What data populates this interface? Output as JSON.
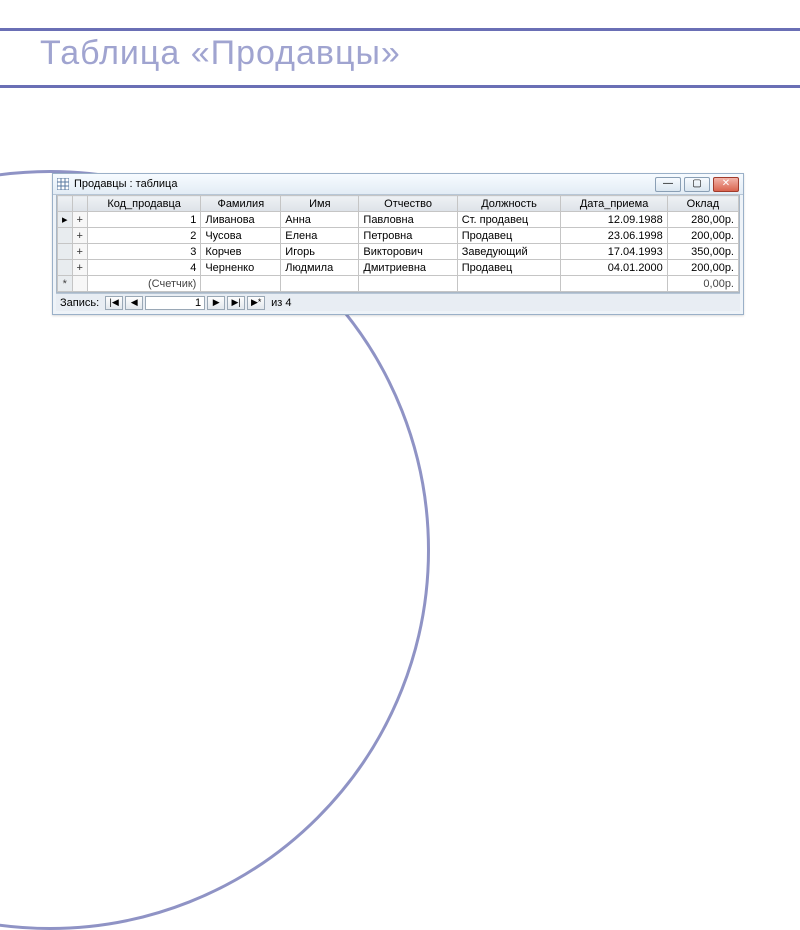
{
  "slide": {
    "title": "Таблица «Продавцы»"
  },
  "window": {
    "title": "Продавцы : таблица"
  },
  "columns": {
    "c0": "Код_продавца",
    "c1": "Фамилия",
    "c2": "Имя",
    "c3": "Отчество",
    "c4": "Должность",
    "c5": "Дата_приема",
    "c6": "Оклад"
  },
  "rows": [
    {
      "sel": "▸",
      "exp": "+",
      "id": "1",
      "fam": "Ливанова",
      "name": "Анна",
      "patr": "Павловна",
      "pos": "Ст. продавец",
      "date": "12.09.1988",
      "sal": "280,00р."
    },
    {
      "sel": "",
      "exp": "+",
      "id": "2",
      "fam": "Чусова",
      "name": "Елена",
      "patr": "Петровна",
      "pos": "Продавец",
      "date": "23.06.1998",
      "sal": "200,00р."
    },
    {
      "sel": "",
      "exp": "+",
      "id": "3",
      "fam": "Корчев",
      "name": "Игорь",
      "patr": "Викторович",
      "pos": "Заведующий",
      "date": "17.04.1993",
      "sal": "350,00р."
    },
    {
      "sel": "",
      "exp": "+",
      "id": "4",
      "fam": "Черненко",
      "name": "Людмила",
      "patr": "Дмитриевна",
      "pos": "Продавец",
      "date": "04.01.2000",
      "sal": "200,00р."
    }
  ],
  "newrow": {
    "sel": "*",
    "idplaceholder": "(Счетчик)",
    "sal": "0,00р."
  },
  "recnav": {
    "label": "Запись:",
    "first": "|◀",
    "prev": "◀",
    "current": "1",
    "next": "▶",
    "last": "▶|",
    "newrec": "▶*",
    "of": "из  4"
  },
  "winbtn": {
    "min": "—",
    "max": "▢",
    "close": "✕"
  }
}
